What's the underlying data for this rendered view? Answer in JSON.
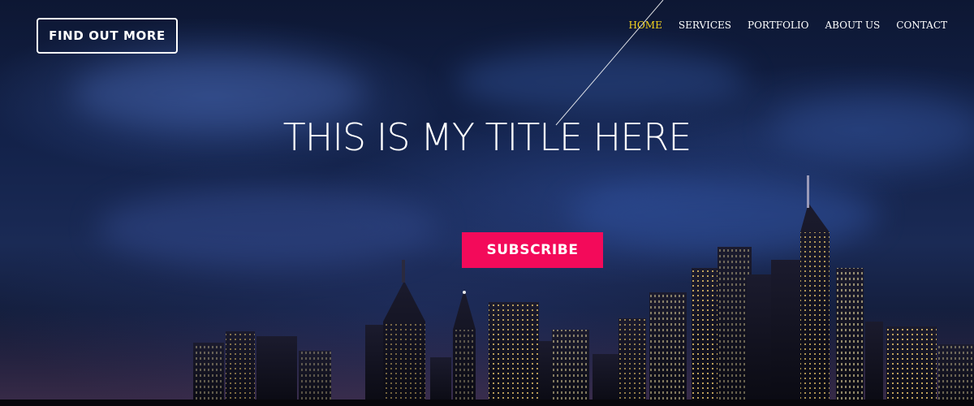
{
  "header": {
    "find_out_more_label": "FIND OUT MORE",
    "nav": [
      {
        "label": "HOME",
        "active": true
      },
      {
        "label": "SERVICES",
        "active": false
      },
      {
        "label": "PORTFOLIO",
        "active": false
      },
      {
        "label": "ABOUT US",
        "active": false
      },
      {
        "label": "CONTACT",
        "active": false
      }
    ]
  },
  "hero": {
    "title": "THIS IS MY TITLE HERE",
    "subscribe_label": "SUBSCRIBE",
    "background_image": "night-city-skyline"
  },
  "colors": {
    "accent": "#f30a5a",
    "nav_active": "#f3d21f",
    "text": "#ffffff",
    "sky_dark": "#0d1733"
  }
}
